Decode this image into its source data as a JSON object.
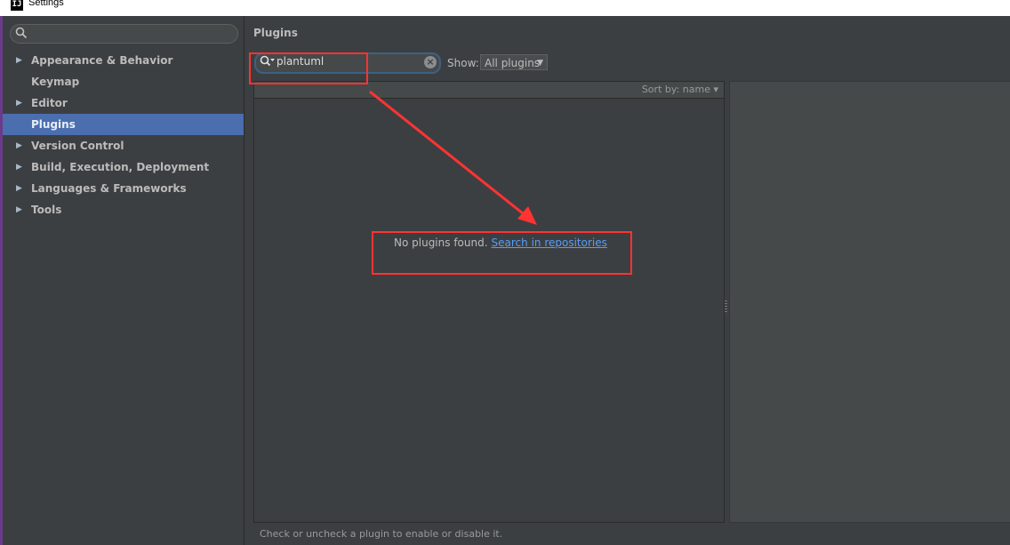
{
  "window": {
    "title": "Settings",
    "app_icon": "intellij-app-icon"
  },
  "sidebar": {
    "search_placeholder": "",
    "items": [
      {
        "label": "Appearance & Behavior",
        "expandable": true,
        "active": false
      },
      {
        "label": "Keymap",
        "expandable": false,
        "active": false
      },
      {
        "label": "Editor",
        "expandable": true,
        "active": false
      },
      {
        "label": "Plugins",
        "expandable": false,
        "active": true
      },
      {
        "label": "Version Control",
        "expandable": true,
        "active": false
      },
      {
        "label": "Build, Execution, Deployment",
        "expandable": true,
        "active": false
      },
      {
        "label": "Languages & Frameworks",
        "expandable": true,
        "active": false
      },
      {
        "label": "Tools",
        "expandable": true,
        "active": false
      }
    ]
  },
  "main": {
    "title": "Plugins",
    "search_value": "plantuml",
    "show_label": "Show:",
    "show_selected": "All plugins",
    "sort_label": "Sort by: name",
    "empty_message": "No plugins found.",
    "repo_link": "Search in repositories",
    "hint": "Check or uncheck a plugin to enable or disable it."
  },
  "colors": {
    "background": "#3c3f41",
    "selection": "#4b6eaf",
    "link": "#589df6",
    "annotation": "#ff3333"
  }
}
